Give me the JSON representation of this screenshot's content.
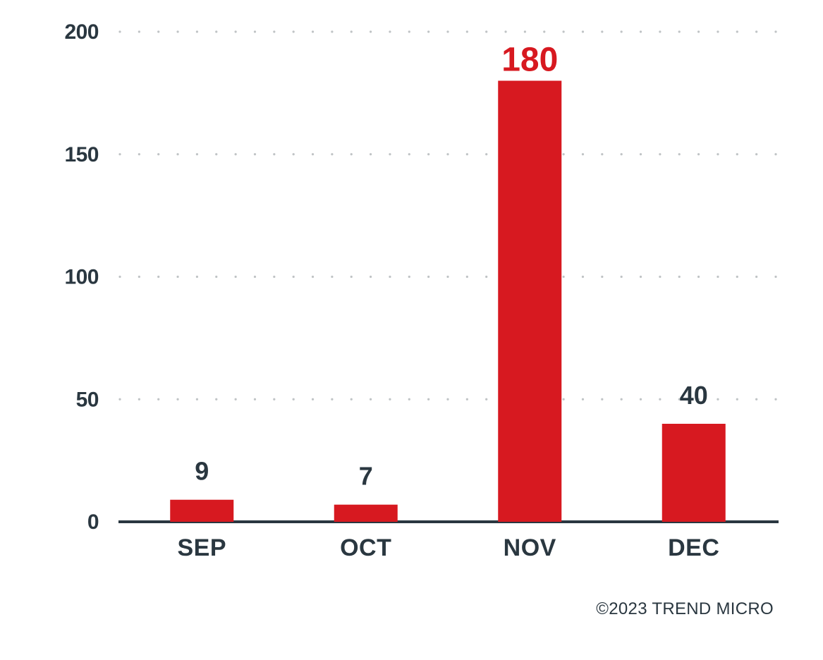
{
  "chart_data": {
    "type": "bar",
    "categories": [
      "SEP",
      "OCT",
      "NOV",
      "DEC"
    ],
    "values": [
      9,
      7,
      180,
      40
    ],
    "value_labels": [
      "9",
      "7",
      "180",
      "40"
    ],
    "title": "",
    "xlabel": "",
    "ylabel": "",
    "ylim": [
      0,
      200
    ],
    "yticks": [
      0,
      50,
      100,
      150,
      200
    ],
    "ytick_labels": [
      "0",
      "50",
      "100",
      "150",
      "200"
    ],
    "highlight_index": 2,
    "bar_color": "#d71920",
    "label_color": "#2a3740",
    "highlight_label_color": "#d71920"
  },
  "copyright": "©2023 TREND MICRO"
}
